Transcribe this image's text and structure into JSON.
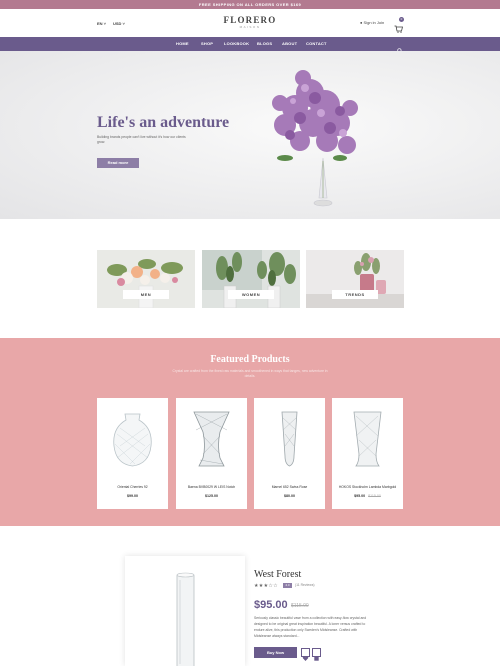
{
  "promo": "FREE SHIPPING ON ALL ORDERS OVER $169",
  "header": {
    "lang": "EN ˅",
    "currency": "USD ˅",
    "logo_main": "FLORERO",
    "logo_sub": "MAISON",
    "signin": "Sign in Join",
    "cart_count": "0"
  },
  "nav": [
    "HOME",
    "SHOP",
    "LOOKBOOK",
    "BLOGS",
    "ABOUT",
    "CONTACT"
  ],
  "hero": {
    "title": "Life's an adventure",
    "text": "Building brands people can't live without it's how our clients grow.",
    "button": "Read more"
  },
  "categories": [
    "MEN",
    "WOMEN",
    "TRENDS"
  ],
  "featured": {
    "title": "Featured Products",
    "subtitle": "Crystal are crafted from the finest raw materials and smoothened in ways that tanges, new adventure in details.",
    "products": [
      {
        "name": "Oriental Cherries 92",
        "price": "$99.00",
        "old": ""
      },
      {
        "name": "Baena BVB0029 W LEIS Notch",
        "price": "$125.00",
        "old": ""
      },
      {
        "name": "Marnel 652 Swiss Rose",
        "price": "$80.00",
        "old": ""
      },
      {
        "name": "HOKOS Stockholm Lambda Marbgold",
        "price": "$95.00",
        "old": "$115.00"
      }
    ]
  },
  "detail": {
    "title": "West Forest",
    "stars": "★★★☆☆",
    "badge": "4.0",
    "reviews": "(11 Reviews)",
    "price": "$95.00",
    "old_price": "$115.00",
    "description": "Seriously classic beautiful vase from a collection with easy-flow crystal and designed to be original great inspiration beautiful. A loner versus crafted to endure alive, this production only Sweden's Midsleanse. Crafted with Midsleanse always standard...",
    "buy": "Buy Now"
  }
}
